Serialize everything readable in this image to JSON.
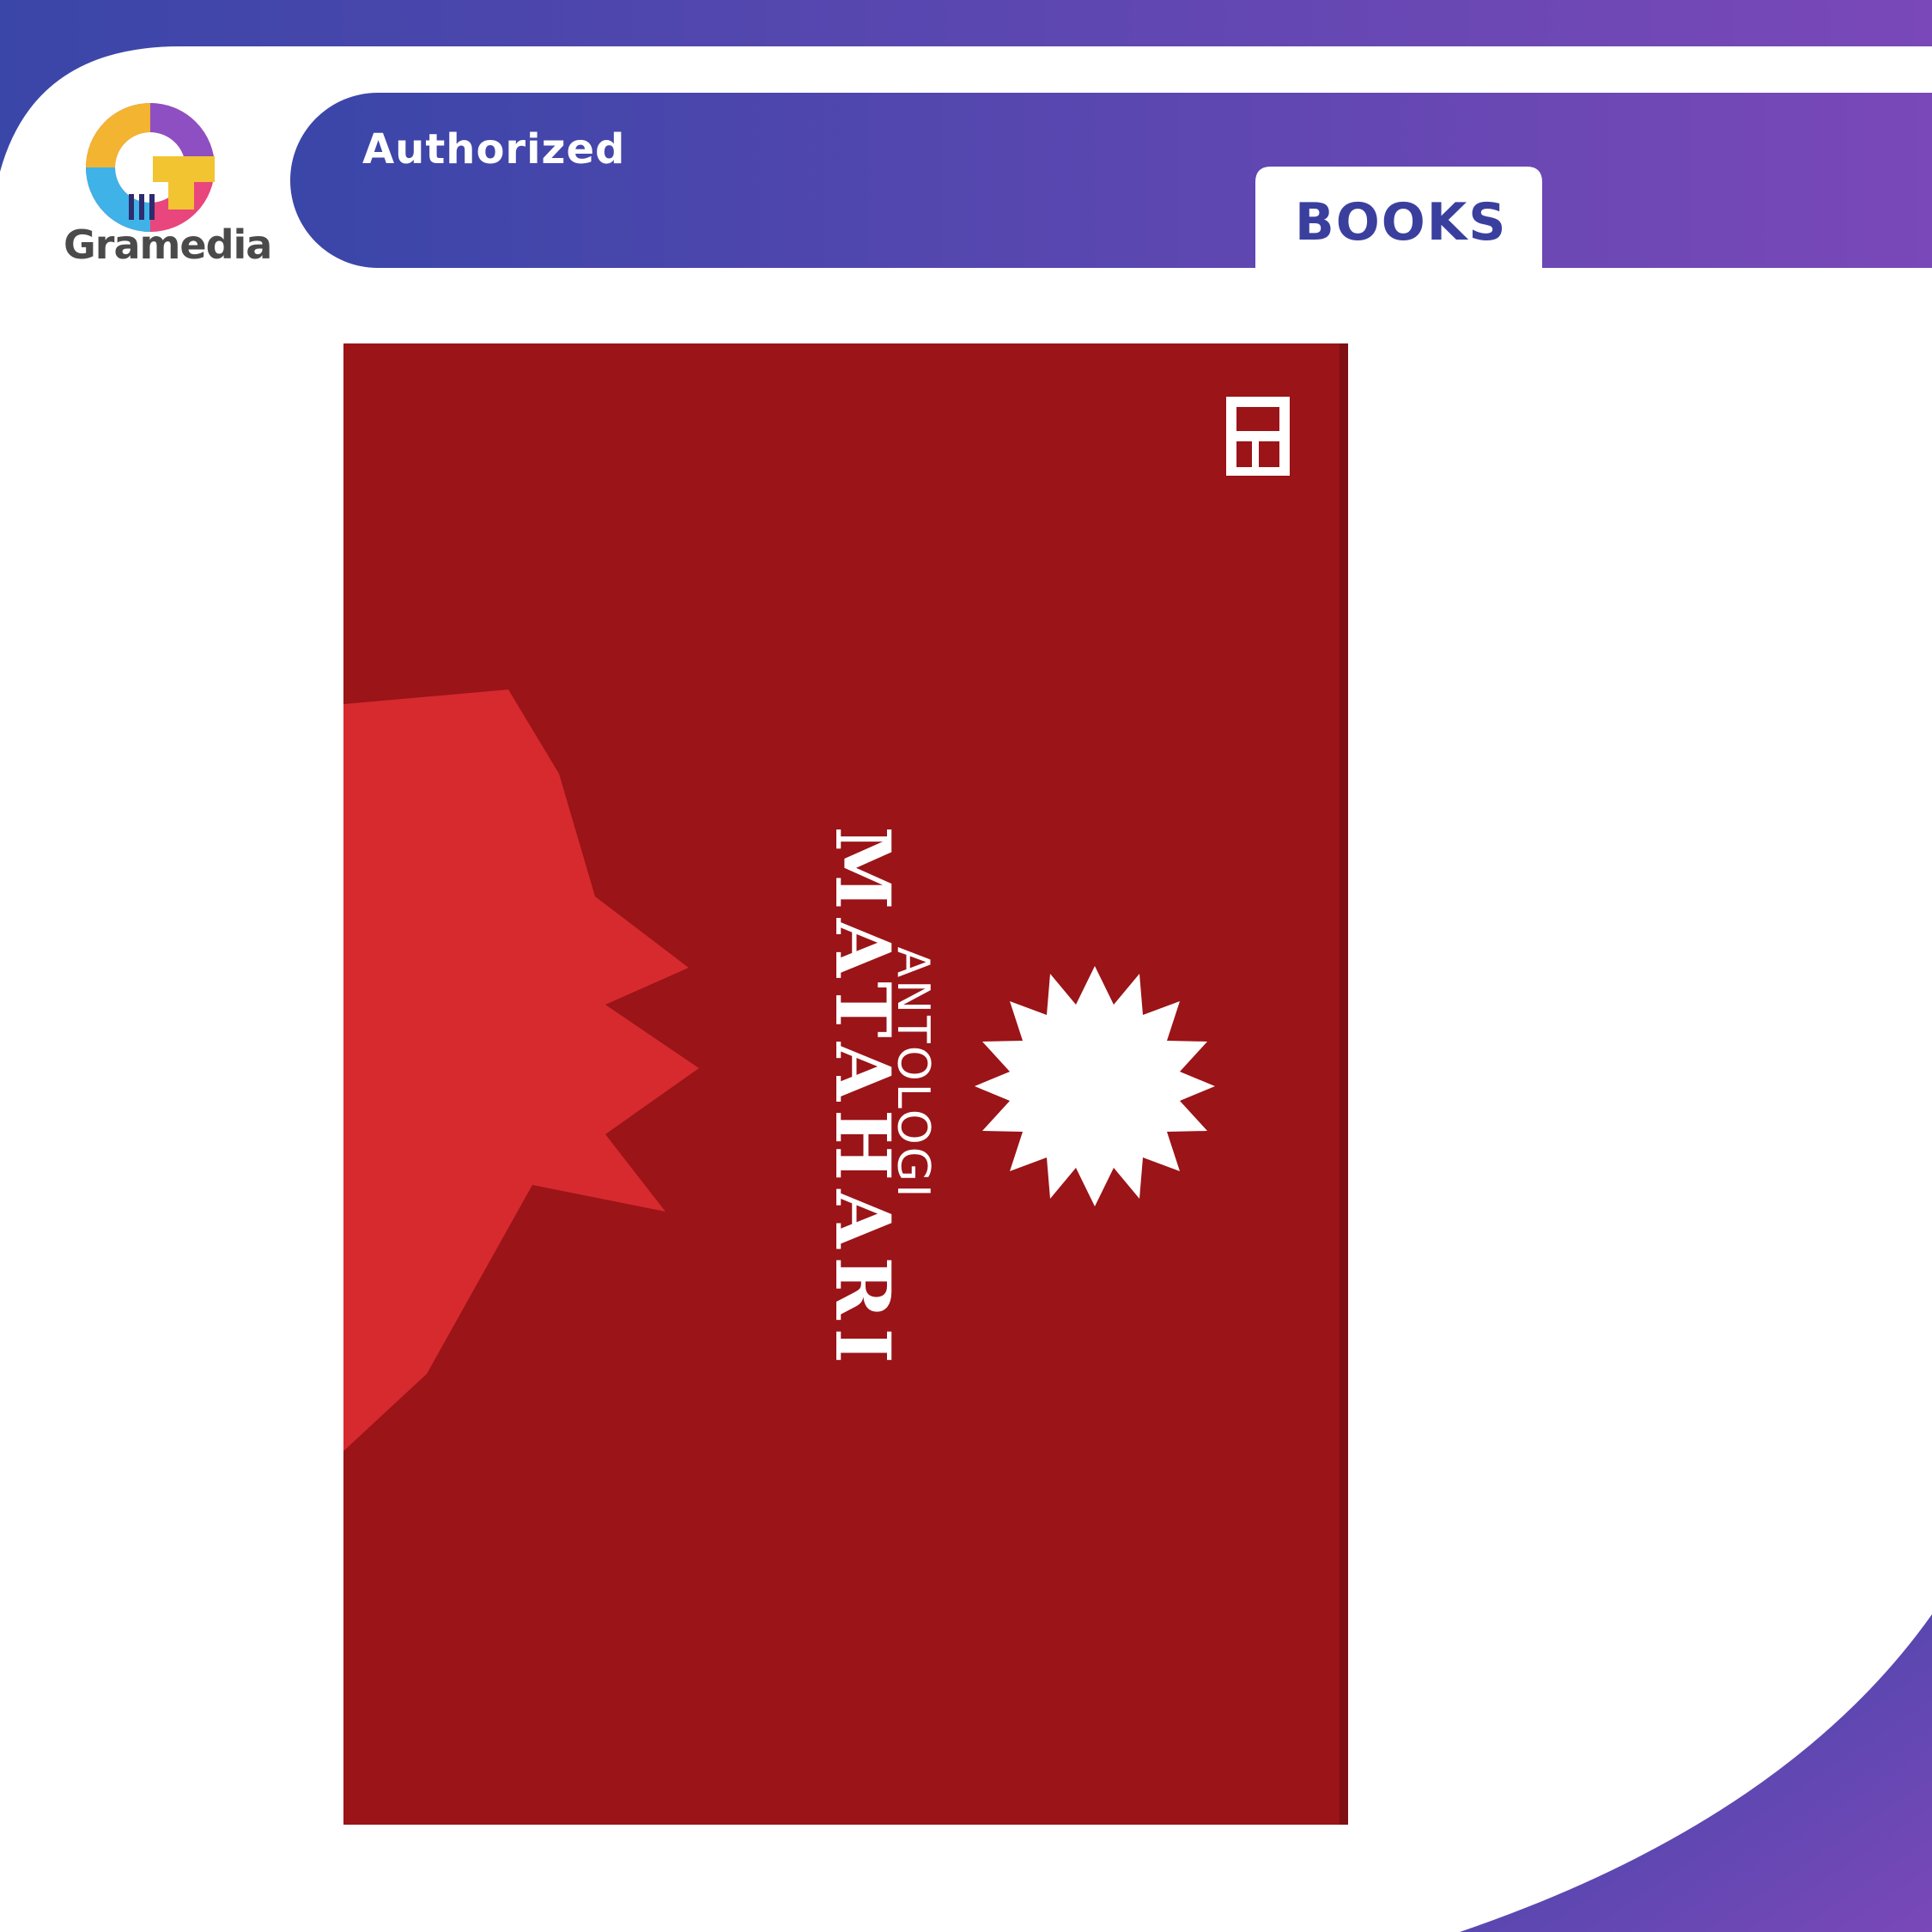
{
  "brand": {
    "name": "Gramedia",
    "logo_icon": "gramedia-g-logo-icon",
    "colors": {
      "blue": "#3a46a8",
      "purple": "#7a48b8",
      "grey_text": "#4a4a4a"
    }
  },
  "banner": {
    "authorized_label": "Authorized",
    "category_tab_label": "BOOKS",
    "category_text_color": "#3a3f9e"
  },
  "cover": {
    "subtitle": "ANTOLOGI",
    "title": "MATAHARI",
    "publisher_icon": "gramedia-publisher-mark-icon",
    "sun_icon": "sun-icon",
    "colors": {
      "background": "#9a1418",
      "star": "#d72a2e",
      "ink": "#ffffff"
    }
  }
}
